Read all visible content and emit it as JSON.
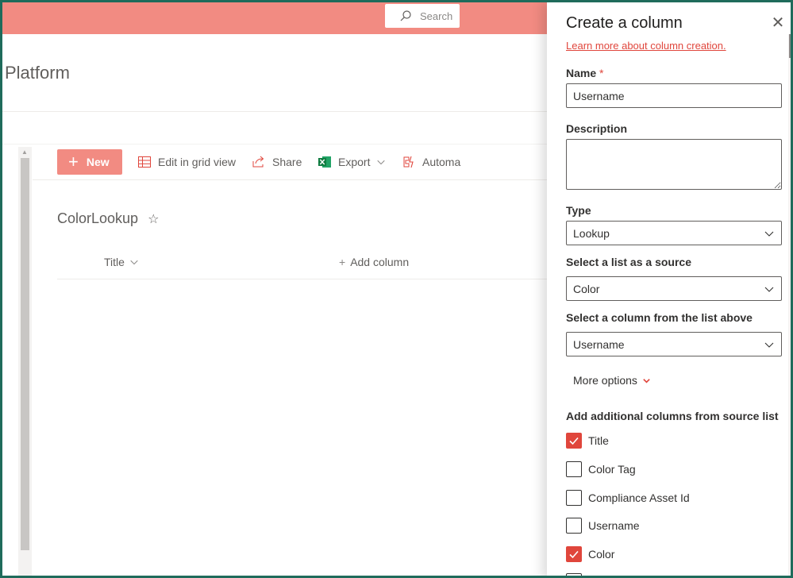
{
  "suitebar": {
    "search_placeholder": "Search",
    "color": "#f28b82"
  },
  "site": {
    "title": "Platform"
  },
  "commandbar": {
    "new_label": "New",
    "edit_grid_label": "Edit in grid view",
    "share_label": "Share",
    "export_label": "Export",
    "automate_label": "Automa"
  },
  "list": {
    "title": "ColorLookup",
    "columns": {
      "title": "Title",
      "add_column": "Add column"
    }
  },
  "panel": {
    "title": "Create a column",
    "learn_more": "Learn more about column creation.",
    "name_label": "Name",
    "required_mark": "*",
    "name_value": "Username",
    "description_label": "Description",
    "description_value": "",
    "type_label": "Type",
    "type_value": "Lookup",
    "source_list_label": "Select a list as a source",
    "source_list_value": "Color",
    "source_column_label": "Select a column from the list above",
    "source_column_value": "Username",
    "more_options": "More options",
    "additional_label": "Add additional columns from source list",
    "additional_columns": [
      {
        "label": "Title",
        "checked": true
      },
      {
        "label": "Color Tag",
        "checked": false
      },
      {
        "label": "Compliance Asset Id",
        "checked": false
      },
      {
        "label": "Username",
        "checked": false
      },
      {
        "label": "Color",
        "checked": true
      }
    ]
  },
  "colors": {
    "accent": "#e0463c",
    "brand_bar": "#f28b82",
    "frame": "#1f6b5b"
  },
  "icons": [
    "search-icon",
    "plus-icon",
    "grid-icon",
    "share-icon",
    "excel-icon",
    "automate-icon",
    "star-icon",
    "close-icon",
    "chevron-down-icon",
    "checkmark-icon"
  ]
}
